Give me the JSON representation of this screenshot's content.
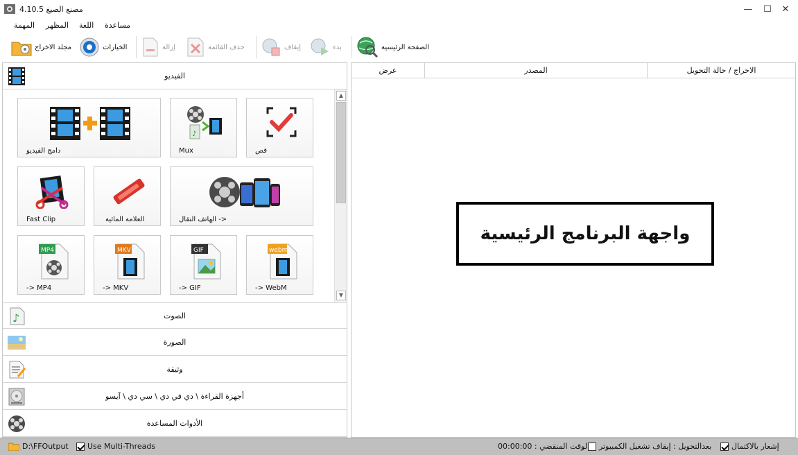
{
  "window": {
    "title": "مصنع الصيغ 4.10.5",
    "minimize": "—",
    "maximize": "☐",
    "close": "✕"
  },
  "menu": {
    "items": [
      "المهمة",
      "المظهر",
      "اللغة",
      "مساعدة"
    ]
  },
  "toolbar": {
    "output_folder": "مجلد الاخراج",
    "options": "الخيارات",
    "remove": "إزالة",
    "clear_list": "حذف القائمة",
    "stop": "إيقاف",
    "start": "بدء",
    "home": "الصفحة الرئيسية"
  },
  "left": {
    "video_category": "الفيديو",
    "tiles": {
      "merge": "دامج الفيديو",
      "mux": "Mux",
      "crop": "قص",
      "fastclip": "Fast Clip",
      "watermark": "العلامة المائية",
      "mobile": "الهاتف النقال ->",
      "mp4": "-> MP4",
      "mp4_badge": "MP4",
      "mkv": "-> MKV",
      "mkv_badge": "MKV",
      "gif": "-> GIF",
      "gif_badge": "GIF",
      "webm": "-> WebM",
      "webm_badge": "webm"
    },
    "categories": {
      "audio": "الصوت",
      "image": "الصورة",
      "document": "وثيقة",
      "rom": "أجهزة القراءة \\ دي في دي \\ سي دي \\ آيسو",
      "tools": "الأدوات المساعدة"
    }
  },
  "right": {
    "col_output": "الاخراج / حالة التحويل",
    "col_source": "المصدر",
    "col_preview": "عرض",
    "overlay_caption": "واجهة البرنامج الرئيسية"
  },
  "status": {
    "output_path": "D:\\FFOutput",
    "multithreads": "Use Multi-Threads",
    "notify": "إشعار بالاكتمال",
    "after_convert": "بعدالتحويل : إيقاف تشغيل الكمبيوتر",
    "elapsed": "00:00:00 : الوقت المنقضي"
  },
  "colors": {
    "statusbar": "#bfbfbf",
    "film_blue": "#2f8fd8",
    "red_accent": "#d9342b",
    "orange": "#f39c12"
  }
}
